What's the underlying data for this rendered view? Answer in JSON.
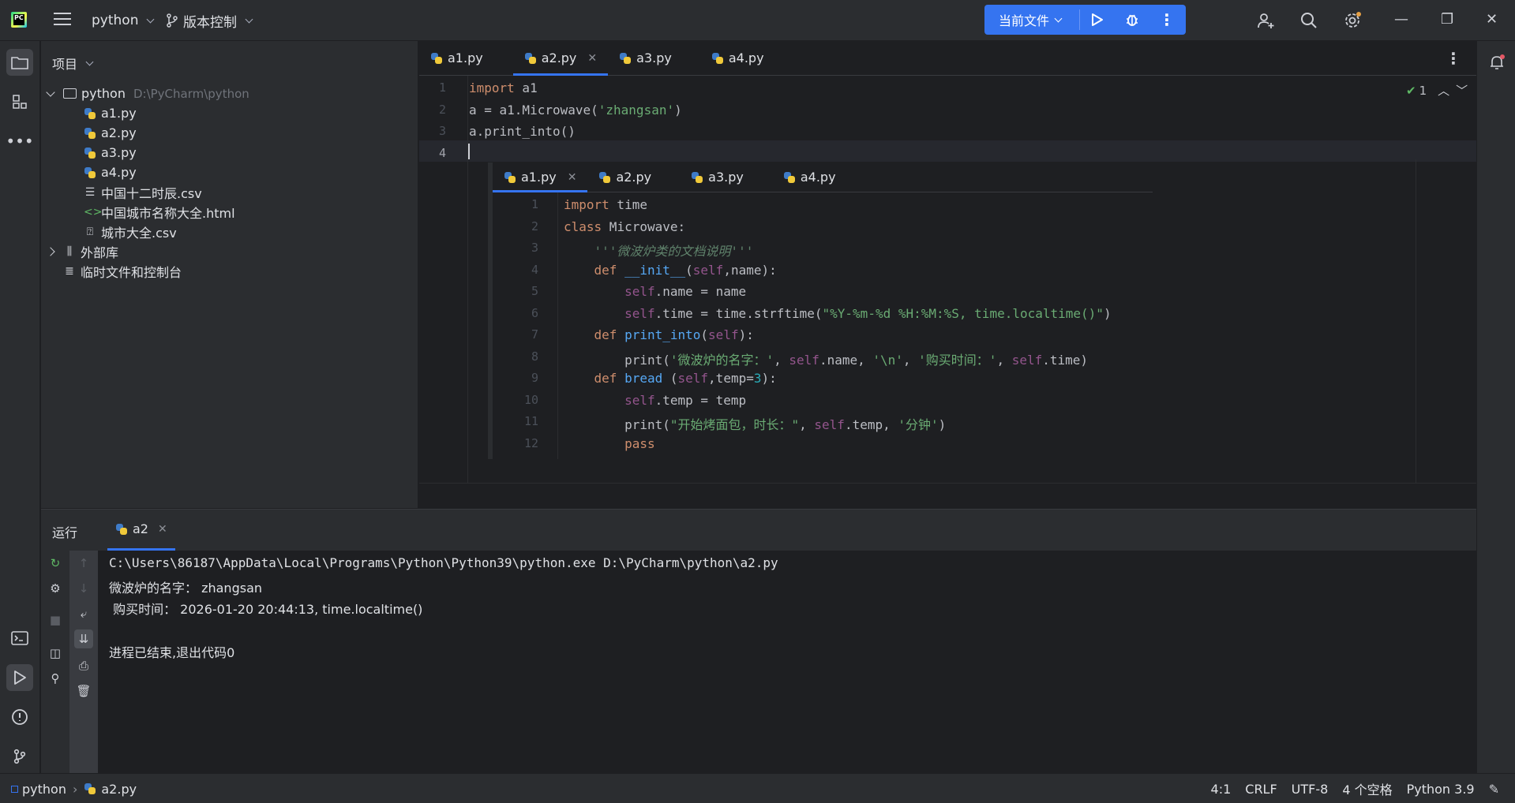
{
  "titlebar": {
    "project_name": "python",
    "vcs_label": "版本控制",
    "run_config": "当前文件"
  },
  "project_panel": {
    "title": "项目",
    "root_name": "python",
    "root_path": "D:\\PyCharm\\python",
    "files": [
      "a1.py",
      "a2.py",
      "a3.py",
      "a4.py",
      "中国十二时辰.csv",
      "中国城市名称大全.html",
      "城市大全.csv"
    ],
    "external_libs": "外部库",
    "scratches": "临时文件和控制台"
  },
  "editor": {
    "tabs": [
      "a1.py",
      "a2.py",
      "a3.py",
      "a4.py"
    ],
    "active_tab": "a2.py",
    "inspection_count": "1",
    "line_numbers": [
      "1",
      "2",
      "3",
      "4"
    ],
    "lines": [
      {
        "tokens": [
          {
            "t": "import",
            "c": "kw"
          },
          {
            "t": " a1",
            "c": ""
          }
        ]
      },
      {
        "tokens": [
          {
            "t": "a = a1.Microwave(",
            "c": ""
          },
          {
            "t": "'zhangsan'",
            "c": "str"
          },
          {
            "t": ")",
            "c": ""
          }
        ]
      },
      {
        "tokens": [
          {
            "t": "a.print_into()",
            "c": ""
          }
        ]
      },
      {
        "tokens": []
      }
    ]
  },
  "preview": {
    "tabs": [
      "a1.py",
      "a2.py",
      "a3.py",
      "a4.py"
    ],
    "active_tab": "a1.py",
    "line_numbers": [
      "1",
      "2",
      "3",
      "4",
      "5",
      "6",
      "7",
      "8",
      "9",
      "10",
      "11",
      "12"
    ],
    "lines": [
      [
        {
          "t": "import",
          "c": "kw"
        },
        {
          "t": " time",
          "c": ""
        }
      ],
      [
        {
          "t": "class",
          "c": "kw"
        },
        {
          "t": " Microwave:",
          "c": ""
        }
      ],
      [
        {
          "t": "    ",
          "c": ""
        },
        {
          "t": "'''微波炉类的文档说明'''",
          "c": "doc"
        }
      ],
      [
        {
          "t": "    ",
          "c": ""
        },
        {
          "t": "def",
          "c": "kw"
        },
        {
          "t": " ",
          "c": ""
        },
        {
          "t": "__init__",
          "c": "fn"
        },
        {
          "t": "(",
          "c": ""
        },
        {
          "t": "self",
          "c": "self"
        },
        {
          "t": ",name):",
          "c": ""
        }
      ],
      [
        {
          "t": "        ",
          "c": ""
        },
        {
          "t": "self",
          "c": "self"
        },
        {
          "t": ".name = name",
          "c": ""
        }
      ],
      [
        {
          "t": "        ",
          "c": ""
        },
        {
          "t": "self",
          "c": "self"
        },
        {
          "t": ".time = time.strftime(",
          "c": ""
        },
        {
          "t": "\"%Y-%m-%d %H:%M:%S, time.localtime()\"",
          "c": "str"
        },
        {
          "t": ")",
          "c": ""
        }
      ],
      [
        {
          "t": "    ",
          "c": ""
        },
        {
          "t": "def",
          "c": "kw"
        },
        {
          "t": " ",
          "c": ""
        },
        {
          "t": "print_into",
          "c": "fn"
        },
        {
          "t": "(",
          "c": ""
        },
        {
          "t": "self",
          "c": "self"
        },
        {
          "t": "):",
          "c": ""
        }
      ],
      [
        {
          "t": "        print(",
          "c": ""
        },
        {
          "t": "'微波炉的名字：'",
          "c": "str"
        },
        {
          "t": ", ",
          "c": ""
        },
        {
          "t": "self",
          "c": "self"
        },
        {
          "t": ".name, ",
          "c": ""
        },
        {
          "t": "'\\n'",
          "c": "str"
        },
        {
          "t": ", ",
          "c": ""
        },
        {
          "t": "'购买时间：'",
          "c": "str"
        },
        {
          "t": ", ",
          "c": ""
        },
        {
          "t": "self",
          "c": "self"
        },
        {
          "t": ".time)",
          "c": ""
        }
      ],
      [
        {
          "t": "    ",
          "c": ""
        },
        {
          "t": "def",
          "c": "kw"
        },
        {
          "t": " ",
          "c": ""
        },
        {
          "t": "bread",
          "c": "fn"
        },
        {
          "t": " (",
          "c": ""
        },
        {
          "t": "self",
          "c": "self"
        },
        {
          "t": ",temp=",
          "c": ""
        },
        {
          "t": "3",
          "c": "num"
        },
        {
          "t": "):",
          "c": ""
        }
      ],
      [
        {
          "t": "        ",
          "c": ""
        },
        {
          "t": "self",
          "c": "self"
        },
        {
          "t": ".temp = temp",
          "c": ""
        }
      ],
      [
        {
          "t": "        print(",
          "c": ""
        },
        {
          "t": "\"开始烤面包，时长：\"",
          "c": "str"
        },
        {
          "t": ", ",
          "c": ""
        },
        {
          "t": "self",
          "c": "self"
        },
        {
          "t": ".temp, ",
          "c": ""
        },
        {
          "t": "'分钟'",
          "c": "str"
        },
        {
          "t": ")",
          "c": ""
        }
      ],
      [
        {
          "t": "        ",
          "c": ""
        },
        {
          "t": "pass",
          "c": "kw"
        }
      ]
    ]
  },
  "run_panel": {
    "title": "运行",
    "tab": "a2",
    "console": [
      "C:\\Users\\86187\\AppData\\Local\\Programs\\Python\\Python39\\python.exe D:\\PyCharm\\python\\a2.py",
      "微波炉的名字： zhangsan",
      " 购买时间： 2026-01-20 20:44:13, time.localtime()",
      "",
      "进程已结束,退出代码0"
    ]
  },
  "statusbar": {
    "breadcrumb_project": "python",
    "breadcrumb_file": "a2.py",
    "position": "4:1",
    "line_sep": "CRLF",
    "encoding": "UTF-8",
    "indent": "4 个空格",
    "interpreter": "Python 3.9"
  },
  "colors": {
    "accent": "#3574f0",
    "keyword": "#cf8e6d",
    "string": "#6aab73",
    "self": "#94558d"
  }
}
